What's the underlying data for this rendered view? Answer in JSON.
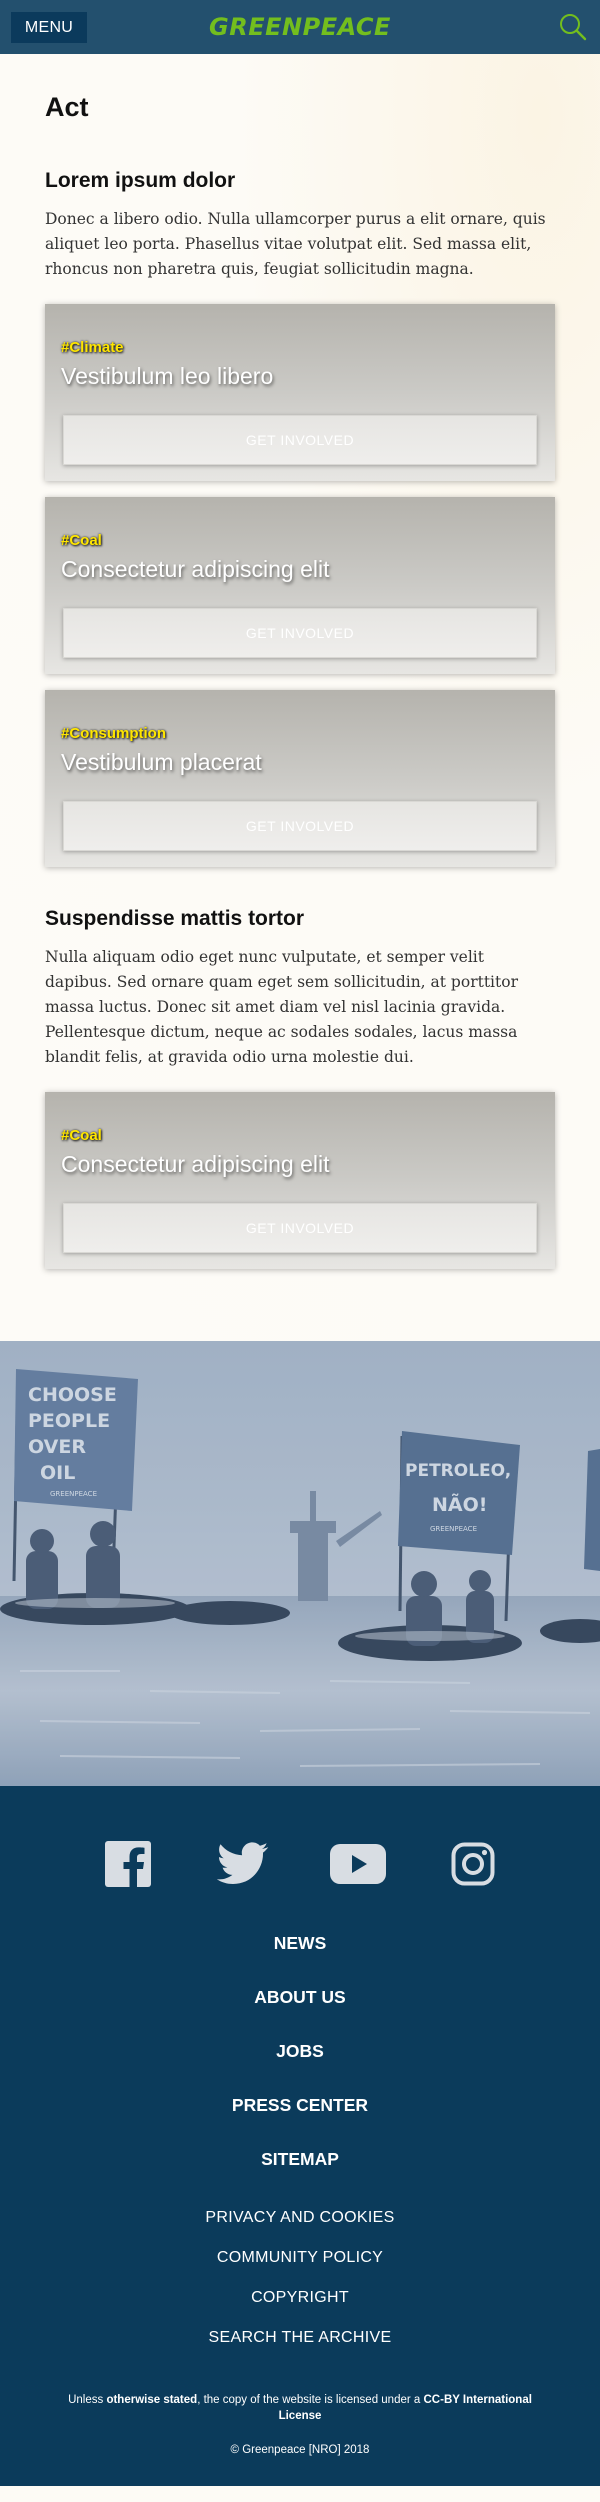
{
  "header": {
    "menu_label": "MENU",
    "logo_text": "GREENPEACE",
    "logo_color": "#73be1e",
    "bg_color": "#23506e",
    "search_icon": "search-icon"
  },
  "main": {
    "title": "Act",
    "sections": [
      {
        "heading": "Lorem ipsum dolor",
        "text": "Donec a libero odio. Nulla ullamcorper purus a elit ornare, quis aliquet leo porta. Phasellus vitae volutpat elit. Sed massa elit, rhoncus non pharetra quis, feugiat sollicitudin magna.",
        "cards": [
          {
            "tag": "#Climate",
            "title": "Vestibulum leo libero",
            "button": "GET INVOLVED"
          },
          {
            "tag": "#Coal",
            "title": "Consectetur adipiscing elit",
            "button": "GET INVOLVED"
          },
          {
            "tag": "#Consumption",
            "title": "Vestibulum placerat",
            "button": "GET INVOLVED"
          }
        ]
      },
      {
        "heading": "Suspendisse mattis tortor",
        "text": "Nulla aliquam odio eget nunc vulputate, et semper velit dapibus. Sed ornare quam eget sem sollicitudin, at porttitor massa luctus. Donec sit amet diam vel nisl lacinia gravida. Pellentesque dictum, neque ac sodales sodales, lacus massa blandit felis, at gravida odio urna molestie dui.",
        "cards": [
          {
            "tag": "#Coal",
            "title": "Consectetur adipiscing elit",
            "button": "GET INVOLVED"
          }
        ]
      }
    ]
  },
  "hero": {
    "banner_left": [
      "CHOOSE",
      "PEOPLE",
      "OVER",
      "OIL"
    ],
    "banner_left_small": "GREENPEACE",
    "banner_right": [
      "PETROLEO,",
      "NÃO!"
    ],
    "banner_right_small": "GREENPEACE"
  },
  "footer": {
    "bg_color": "#0b3b5b",
    "social": [
      "facebook-icon",
      "twitter-icon",
      "youtube-icon",
      "instagram-icon"
    ],
    "main_links": [
      "NEWS",
      "ABOUT US",
      "JOBS",
      "PRESS CENTER",
      "SITEMAP"
    ],
    "sub_links": [
      "PRIVACY AND COOKIES",
      "COMMUNITY POLICY",
      "COPYRIGHT",
      "SEARCH THE ARCHIVE"
    ],
    "license_prefix": "Unless ",
    "license_bold1": "otherwise stated",
    "license_mid": ", the copy of the website is licensed under a ",
    "license_bold2": "CC-BY International License",
    "copyright": "© Greenpeace [NRO] 2018"
  }
}
